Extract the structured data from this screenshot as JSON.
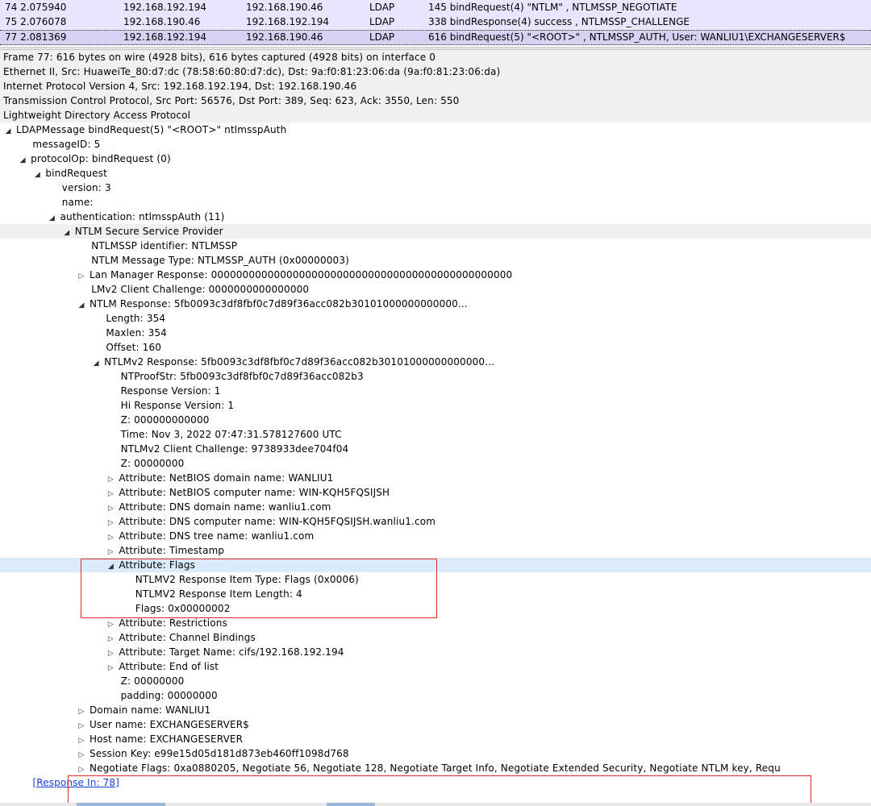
{
  "packets": [
    {
      "no": "74 2.075940",
      "src": "192.168.192.194",
      "dst": "192.168.190.46",
      "proto": "LDAP",
      "info": "145 bindRequest(4) \"NTLM\" , NTLMSSP_NEGOTIATE"
    },
    {
      "no": "75 2.076078",
      "src": "192.168.190.46",
      "dst": "192.168.192.194",
      "proto": "LDAP",
      "info": "338 bindResponse(4) success , NTLMSSP_CHALLENGE"
    },
    {
      "no": "77 2.081369",
      "src": "192.168.192.194",
      "dst": "192.168.190.46",
      "proto": "LDAP",
      "info": "616 bindRequest(5) \"<ROOT>\" , NTLMSSP_AUTH, User: WANLIU1\\EXCHANGESERVER$"
    }
  ],
  "tree": [
    {
      "indent": 0,
      "arrow": "",
      "text": "Frame 77: 616 bytes on wire (4928 bits), 616 bytes captured (4928 bits) on interface 0",
      "style": "gray"
    },
    {
      "indent": 0,
      "arrow": "",
      "text": "Ethernet II, Src: HuaweiTe_80:d7:dc (78:58:60:80:d7:dc), Dst: 9a:f0:81:23:06:da (9a:f0:81:23:06:da)",
      "style": "gray"
    },
    {
      "indent": 0,
      "arrow": "",
      "text": "Internet Protocol Version 4, Src: 192.168.192.194, Dst: 192.168.190.46",
      "style": "gray"
    },
    {
      "indent": 0,
      "arrow": "",
      "text": "Transmission Control Protocol, Src Port: 56576, Dst Port: 389, Seq: 623, Ack: 3550, Len: 550",
      "style": "gray"
    },
    {
      "indent": 0,
      "arrow": "",
      "text": "Lightweight Directory Access Protocol",
      "style": "gray"
    },
    {
      "indent": 0,
      "arrow": "expanded",
      "text": "LDAPMessage bindRequest(5) \"<ROOT>\" ntlmsspAuth",
      "style": ""
    },
    {
      "indent": 2,
      "arrow": "",
      "text": "messageID: 5",
      "style": ""
    },
    {
      "indent": 1,
      "arrow": "expanded",
      "text": "protocolOp: bindRequest (0)",
      "style": ""
    },
    {
      "indent": 2,
      "arrow": "expanded",
      "text": "bindRequest",
      "style": ""
    },
    {
      "indent": 4,
      "arrow": "",
      "text": "version: 3",
      "style": ""
    },
    {
      "indent": 4,
      "arrow": "",
      "text": "name:",
      "style": ""
    },
    {
      "indent": 3,
      "arrow": "expanded",
      "text": "authentication: ntlmsspAuth (11)",
      "style": ""
    },
    {
      "indent": 4,
      "arrow": "expanded",
      "text": "NTLM Secure Service Provider",
      "style": "gray"
    },
    {
      "indent": 6,
      "arrow": "",
      "text": "NTLMSSP identifier: NTLMSSP",
      "style": ""
    },
    {
      "indent": 6,
      "arrow": "",
      "text": "NTLM Message Type: NTLMSSP_AUTH (0x00000003)",
      "style": ""
    },
    {
      "indent": 5,
      "arrow": "collapsed",
      "text": "Lan Manager Response: 000000000000000000000000000000000000000000000000",
      "style": ""
    },
    {
      "indent": 6,
      "arrow": "",
      "text": "LMv2 Client Challenge: 0000000000000000",
      "style": ""
    },
    {
      "indent": 5,
      "arrow": "expanded",
      "text": "NTLM Response: 5fb0093c3df8fbf0c7d89f36acc082b30101000000000000...",
      "style": ""
    },
    {
      "indent": 7,
      "arrow": "",
      "text": "Length: 354",
      "style": ""
    },
    {
      "indent": 7,
      "arrow": "",
      "text": "Maxlen: 354",
      "style": ""
    },
    {
      "indent": 7,
      "arrow": "",
      "text": "Offset: 160",
      "style": ""
    },
    {
      "indent": 6,
      "arrow": "expanded",
      "text": "NTLMv2 Response: 5fb0093c3df8fbf0c7d89f36acc082b30101000000000000...",
      "style": ""
    },
    {
      "indent": 8,
      "arrow": "",
      "text": "NTProofStr: 5fb0093c3df8fbf0c7d89f36acc082b3",
      "style": ""
    },
    {
      "indent": 8,
      "arrow": "",
      "text": "Response Version: 1",
      "style": ""
    },
    {
      "indent": 8,
      "arrow": "",
      "text": "Hi Response Version: 1",
      "style": ""
    },
    {
      "indent": 8,
      "arrow": "",
      "text": "Z: 000000000000",
      "style": ""
    },
    {
      "indent": 8,
      "arrow": "",
      "text": "Time: Nov  3, 2022 07:47:31.578127600 UTC",
      "style": ""
    },
    {
      "indent": 8,
      "arrow": "",
      "text": "NTLMv2 Client Challenge: 9738933dee704f04",
      "style": ""
    },
    {
      "indent": 8,
      "arrow": "",
      "text": "Z: 00000000",
      "style": ""
    },
    {
      "indent": 7,
      "arrow": "collapsed",
      "text": "Attribute: NetBIOS domain name: WANLIU1",
      "style": ""
    },
    {
      "indent": 7,
      "arrow": "collapsed",
      "text": "Attribute: NetBIOS computer name: WIN-KQH5FQSIJSH",
      "style": ""
    },
    {
      "indent": 7,
      "arrow": "collapsed",
      "text": "Attribute: DNS domain name: wanliu1.com",
      "style": ""
    },
    {
      "indent": 7,
      "arrow": "collapsed",
      "text": "Attribute: DNS computer name: WIN-KQH5FQSIJSH.wanliu1.com",
      "style": ""
    },
    {
      "indent": 7,
      "arrow": "collapsed",
      "text": "Attribute: DNS tree name: wanliu1.com",
      "style": ""
    },
    {
      "indent": 7,
      "arrow": "collapsed",
      "text": "Attribute: Timestamp",
      "style": ""
    },
    {
      "indent": 7,
      "arrow": "expanded",
      "text": "Attribute: Flags",
      "style": "blue"
    },
    {
      "indent": 9,
      "arrow": "",
      "text": "NTLMV2 Response Item Type: Flags (0x0006)",
      "style": ""
    },
    {
      "indent": 9,
      "arrow": "",
      "text": "NTLMV2 Response Item Length: 4",
      "style": ""
    },
    {
      "indent": 9,
      "arrow": "",
      "text": "Flags: 0x00000002",
      "style": ""
    },
    {
      "indent": 7,
      "arrow": "collapsed",
      "text": "Attribute: Restrictions",
      "style": ""
    },
    {
      "indent": 7,
      "arrow": "collapsed",
      "text": "Attribute: Channel Bindings",
      "style": ""
    },
    {
      "indent": 7,
      "arrow": "collapsed",
      "text": "Attribute: Target Name: cifs/192.168.192.194",
      "style": ""
    },
    {
      "indent": 7,
      "arrow": "collapsed",
      "text": "Attribute: End of list",
      "style": ""
    },
    {
      "indent": 8,
      "arrow": "",
      "text": "Z: 00000000",
      "style": ""
    },
    {
      "indent": 8,
      "arrow": "",
      "text": "padding: 00000000",
      "style": ""
    },
    {
      "indent": 5,
      "arrow": "collapsed",
      "text": "Domain name: WANLIU1",
      "style": ""
    },
    {
      "indent": 5,
      "arrow": "collapsed",
      "text": "User name: EXCHANGESERVER$",
      "style": ""
    },
    {
      "indent": 5,
      "arrow": "collapsed",
      "text": "Host name: EXCHANGESERVER",
      "style": ""
    },
    {
      "indent": 5,
      "arrow": "collapsed",
      "text": "Session Key: e99e15d05d181d873eb460ff1098d768",
      "style": ""
    },
    {
      "indent": 5,
      "arrow": "collapsed",
      "text": "Negotiate Flags: 0xa0880205, Negotiate 56, Negotiate 128, Negotiate Target Info, Negotiate Extended Security, Negotiate NTLM key, Requ",
      "style": ""
    },
    {
      "indent": 2,
      "arrow": "",
      "text": "[Response In: 78]",
      "style": "link"
    }
  ],
  "icons": {
    "expanded": "triangle-down-icon",
    "collapsed": "triangle-right-icon"
  },
  "colors": {
    "highlight_box": "#e32b2b",
    "selected_row": "#d6d2f3",
    "ldap_row": "#e9e5ff",
    "link": "#1a3fd6"
  }
}
